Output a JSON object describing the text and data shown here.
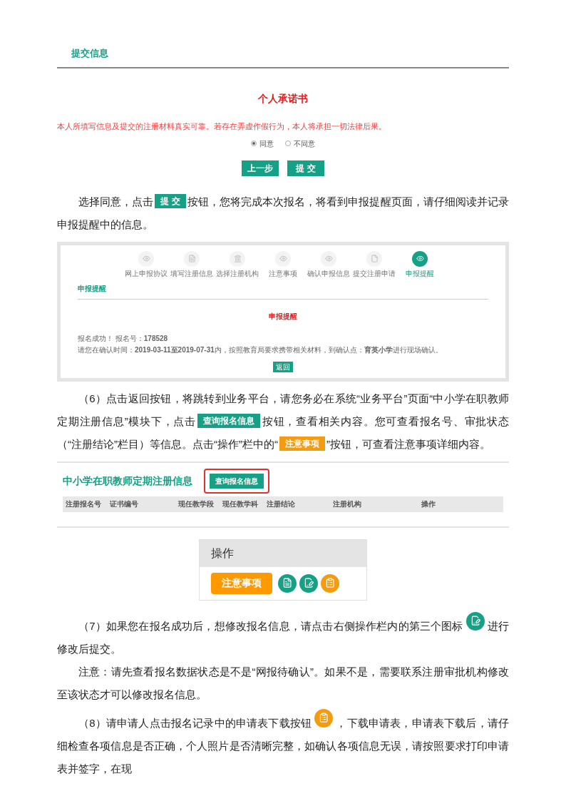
{
  "section_header": {
    "title": "提交信息"
  },
  "pledge": {
    "title": "个人承诺书",
    "statement": "本人所填写信息及提交的注册材料真实可靠。若存在弄虚作假行为，本人将承担一切法律后果。",
    "options": [
      {
        "label": "同意",
        "selected": true
      },
      {
        "label": "不同意",
        "selected": false
      }
    ],
    "buttons": [
      "上一步",
      "提 交"
    ]
  },
  "paragraph_1": [
    {
      "kind": "text",
      "text": "选择同意，点击"
    },
    {
      "kind": "button",
      "text": "提 交",
      "color": "#16a085"
    },
    {
      "kind": "text",
      "text": "按钮，您将完成本次报名，将看到申报提醒页面，请仔细阅读并记录申报提醒中的信息。"
    }
  ],
  "reminder_screen": {
    "steps": [
      {
        "label": "网上申报协议",
        "selected": false
      },
      {
        "label": "填写注册信息",
        "selected": false
      },
      {
        "label": "选择注册机构",
        "selected": false
      },
      {
        "label": "注意事项",
        "selected": false
      },
      {
        "label": "确认申报信息",
        "selected": false
      },
      {
        "label": "提交注册申请",
        "selected": false
      },
      {
        "label": "申报提醒",
        "selected": true
      }
    ],
    "section_title": "申报提醒",
    "heading": "申报提醒",
    "line_1": "报名成功！ 报名号：**178528**",
    "line_2": "请您在确认时间：**2019-03-11至2019-07-31**内，按照教育局要求携带相关材料，到确认点：**育英小学**进行现场确认。",
    "back_button": "返回"
  },
  "paragraph_6": [
    {
      "kind": "text",
      "text": "（6）点击返回按钮，将跳转到业务平台，请您务必在系统“业务平台”页面“中小学在职教师定期注册信息”模块下，点击"
    },
    {
      "kind": "button",
      "text": "查询报名信息",
      "color": "#16a085"
    },
    {
      "kind": "text",
      "text": "按钮，查看相关内容。您可查看报名号、审批状态（“注册结论”栏目）等信息。点击“操作”栏中的“"
    },
    {
      "kind": "button",
      "text": "注意事项",
      "color": "#f39c12"
    },
    {
      "kind": "text",
      "text": "”按钮，可查看注意事项详细内容。"
    }
  ],
  "registration_screen": {
    "title": "中小学在职教师定期注册信息",
    "query_button": "查询报名信息",
    "columns": [
      "注册报名号",
      "证书编号",
      "现任教学段",
      "现任教学科",
      "注册结论",
      "注册机构",
      "操作"
    ]
  },
  "actions_screen": {
    "header": "操作",
    "notice_button": "注意事项"
  },
  "paragraph_7": [
    {
      "kind": "text",
      "text": "（7）如果您在报名成功后，想修改报名信息，请点击右侧操作栏内的第三个图标"
    },
    {
      "kind": "editbadge",
      "color": "#16a085"
    },
    {
      "kind": "text",
      "text": "进行修改后提交。"
    }
  ],
  "note": "注意：请先查看报名数据状态是不是“网报待确认”。如果不是，需要联系注册审批机构修改至该状态才可以修改报名信息。",
  "paragraph_8": [
    {
      "kind": "text",
      "text": "（8）请申请人点击报名记录中的申请表下载按钮"
    },
    {
      "kind": "formbadge",
      "color": "#f39c12"
    },
    {
      "kind": "text",
      "text": "，下载申请表，申请表下载后，请仔细检查各项信息是否正确，个人照片是否清晰完整，如确认各项信息无误，请按照要求打印申请表并签字，在现"
    }
  ]
}
